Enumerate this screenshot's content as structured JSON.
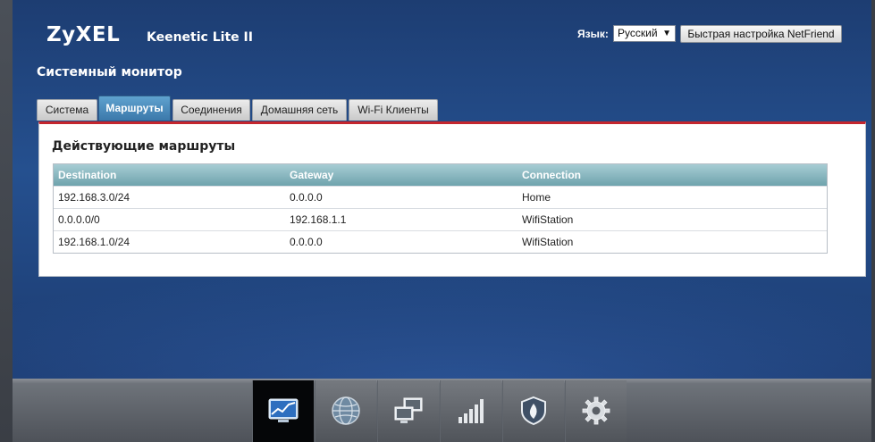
{
  "header": {
    "logo": "ZyXEL",
    "product": "Keenetic Lite II",
    "language_label": "Язык:",
    "language_value": "Русский",
    "netfriend_button": "Быстрая настройка NetFriend"
  },
  "page": {
    "title": "Системный монитор",
    "tabs": [
      {
        "label": "Система"
      },
      {
        "label": "Маршруты",
        "active": true
      },
      {
        "label": "Соединения"
      },
      {
        "label": "Домашняя сеть"
      },
      {
        "label": "Wi-Fi Клиенты"
      }
    ]
  },
  "routes": {
    "section_title": "Действующие маршруты",
    "columns": [
      "Destination",
      "Gateway",
      "Connection"
    ],
    "rows": [
      [
        "192.168.3.0/24",
        "0.0.0.0",
        "Home"
      ],
      [
        "0.0.0.0/0",
        "192.168.1.1",
        "WifiStation"
      ],
      [
        "192.168.1.0/24",
        "0.0.0.0",
        "WifiStation"
      ]
    ]
  },
  "dock": {
    "items": [
      {
        "icon": "monitor-chart-icon",
        "active": true
      },
      {
        "icon": "globe-icon"
      },
      {
        "icon": "computers-network-icon"
      },
      {
        "icon": "signal-bars-icon"
      },
      {
        "icon": "shield-icon"
      },
      {
        "icon": "gear-icon"
      }
    ]
  },
  "colors": {
    "accent_red": "#c4262e",
    "active_tab": "#3b78aa",
    "table_header": "#6fa3ad"
  }
}
